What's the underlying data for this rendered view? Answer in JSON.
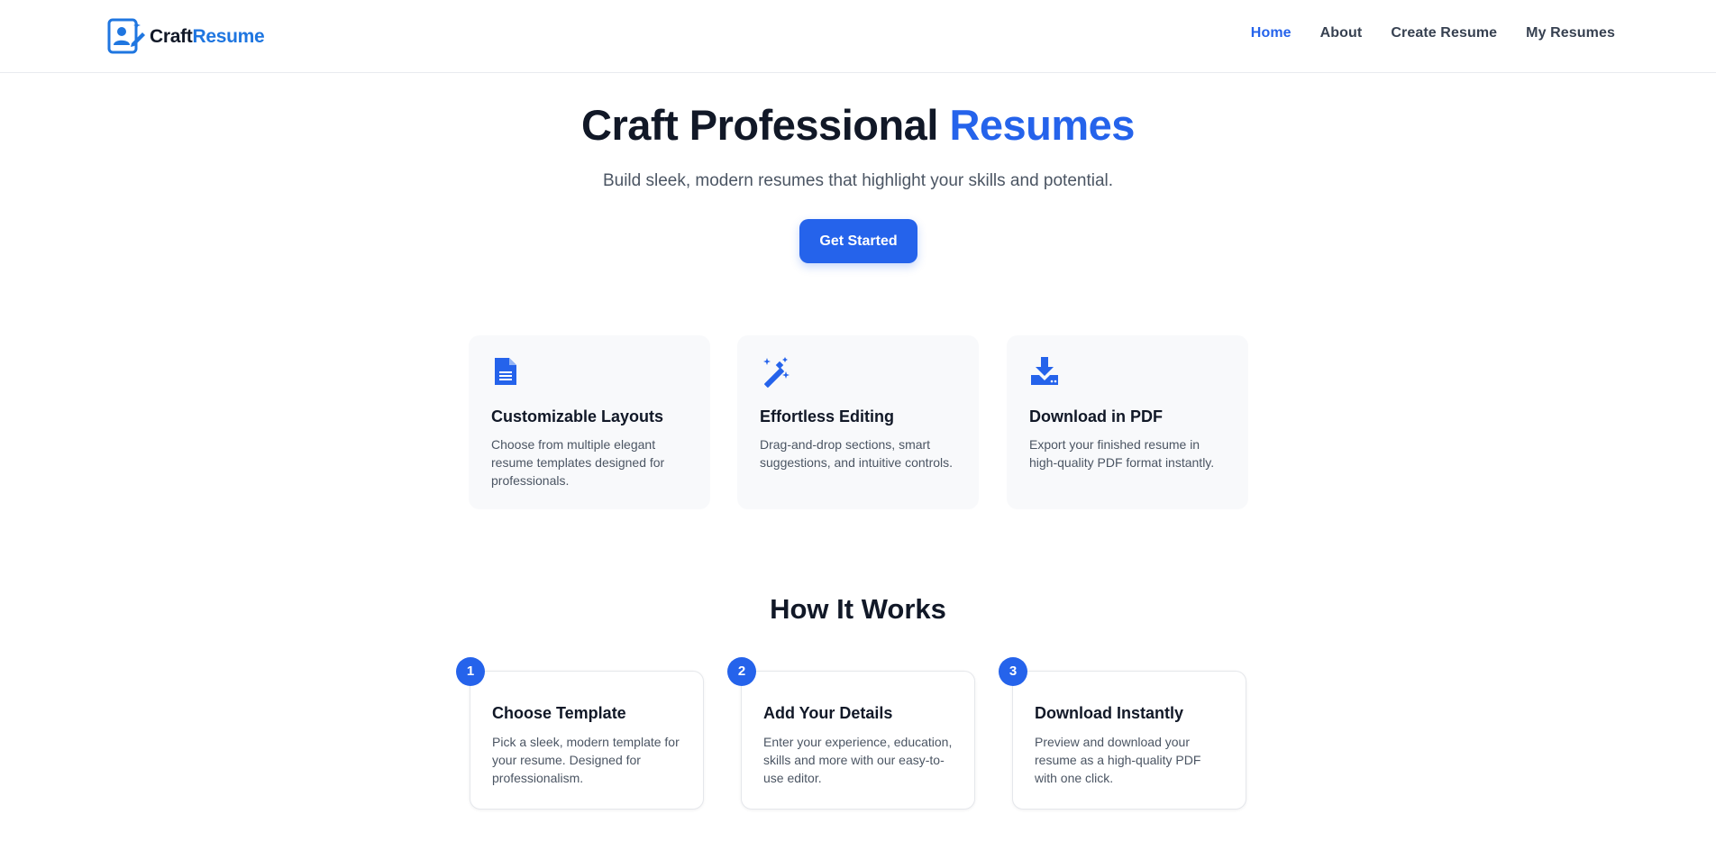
{
  "brand": {
    "name_part1": "Craft",
    "name_part2": "Resume",
    "icon": "resume-logo-icon",
    "color_primary": "#1f76e0"
  },
  "nav": {
    "items": [
      {
        "label": "Home",
        "active": true
      },
      {
        "label": "About",
        "active": false
      },
      {
        "label": "Create Resume",
        "active": false
      },
      {
        "label": "My Resumes",
        "active": false
      }
    ]
  },
  "hero": {
    "title_main": "Craft Professional",
    "title_accent": "Resumes",
    "subtitle": "Build sleek, modern resumes that highlight your skills and potential.",
    "cta_label": "Get Started"
  },
  "features": [
    {
      "icon": "document-icon",
      "title": "Customizable Layouts",
      "text": "Choose from multiple elegant resume templates designed for professionals."
    },
    {
      "icon": "magic-wand-icon",
      "title": "Effortless Editing",
      "text": "Drag-and-drop sections, smart suggestions, and intuitive controls."
    },
    {
      "icon": "download-icon",
      "title": "Download in PDF",
      "text": "Export your finished resume in high-quality PDF format instantly."
    }
  ],
  "how_it_works": {
    "title": "How It Works",
    "steps": [
      {
        "number": "1",
        "title": "Choose Template",
        "text": "Pick a sleek, modern template for your resume. Designed for professionalism."
      },
      {
        "number": "2",
        "title": "Add Your Details",
        "text": "Enter your experience, education, skills and more with our easy-to-use editor."
      },
      {
        "number": "3",
        "title": "Download Instantly",
        "text": "Preview and download your resume as a high-quality PDF with one click."
      }
    ]
  },
  "colors": {
    "accent": "#2563eb",
    "heading": "#111827",
    "body_text": "#4b5563",
    "card_bg": "#f8f9fb"
  }
}
